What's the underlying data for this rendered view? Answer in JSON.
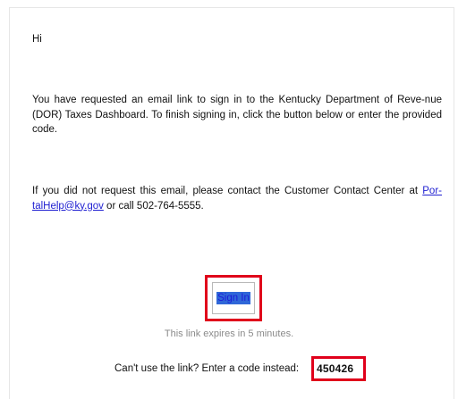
{
  "email": {
    "greeting": "Hi",
    "paragraph1": "You have requested an email link to sign in to the Kentucky Department of Reve-nue (DOR) Taxes Dashboard. To finish signing in, click the button below or enter the provided code.",
    "paragraph2_prefix": "If you did not request this email, please contact the Customer Contact Center at ",
    "support_email": "Por-talHelp@ky.gov",
    "paragraph2_suffix": " or call 502-764-5555.",
    "signin_button_label": "Sign In",
    "expiry_note": "This link expires in 5 minutes.",
    "code_prompt": "Can't use the link? Enter a code instead:",
    "code": "450426"
  },
  "colors": {
    "highlight_border": "#e0001b",
    "link": "#1f1fd1",
    "button_selection": "#2f67d8"
  }
}
